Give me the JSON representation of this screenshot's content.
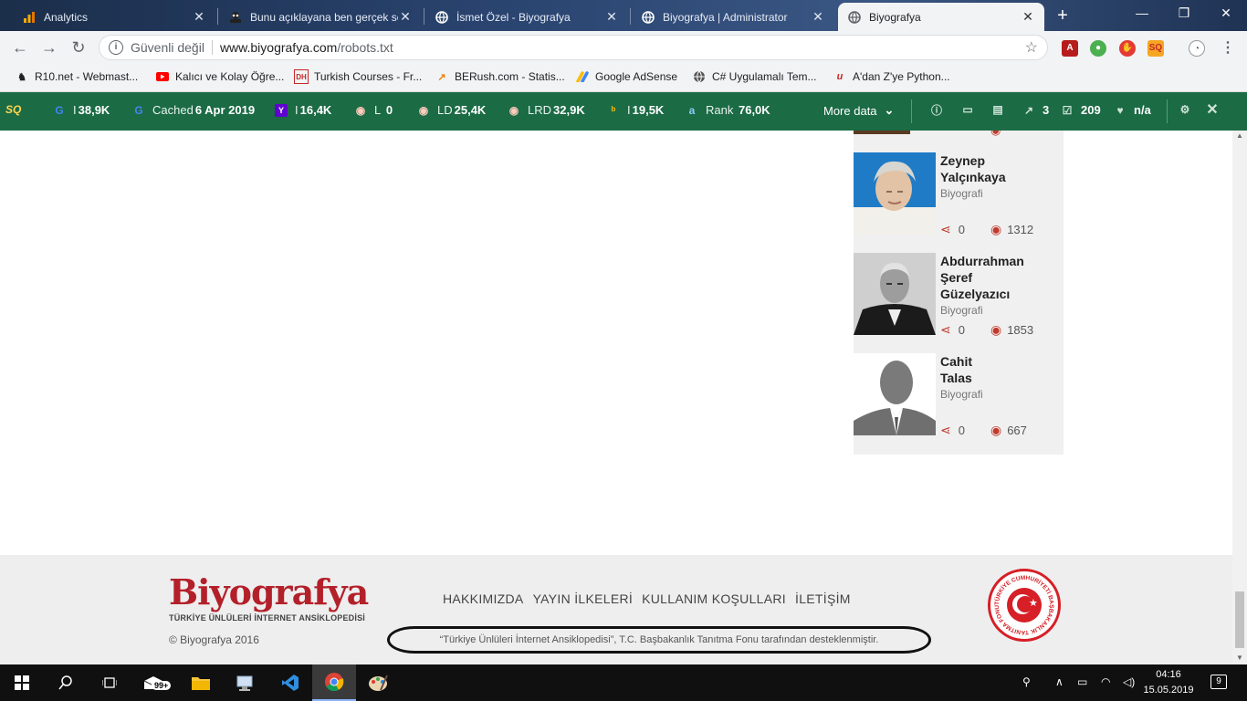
{
  "browser": {
    "tabs": [
      {
        "title": "Analytics",
        "icon": "analytics-icon"
      },
      {
        "title": "Bunu açıklayana ben gerçek se",
        "icon": "spy-icon"
      },
      {
        "title": "İsmet Özel - Biyografya",
        "icon": "globe-icon"
      },
      {
        "title": "Biyografya | Administrator",
        "icon": "globe-icon"
      },
      {
        "title": "Biyografya",
        "icon": "globe-icon",
        "active": true
      }
    ],
    "omnibox": {
      "security": "Güvenli değil",
      "domain": "www.biyografya.com",
      "path": "/robots.txt"
    },
    "bookmarks": [
      {
        "label": "R10.net - Webmast...",
        "icon": "r10-icon"
      },
      {
        "label": "Kalıcı ve Kolay Öğre...",
        "icon": "youtube-icon"
      },
      {
        "label": "Turkish Courses - Fr...",
        "icon": "dil-icon"
      },
      {
        "label": "BERush.com - Statis...",
        "icon": "berush-icon"
      },
      {
        "label": "Google AdSense",
        "icon": "adsense-icon"
      },
      {
        "label": "C# Uygulamalı Tem...",
        "icon": "globe-icon"
      },
      {
        "label": "A'dan Z'ye Python...",
        "icon": "udemy-icon"
      }
    ]
  },
  "seoquake": {
    "logo": "SQ",
    "metrics": [
      {
        "label": "I",
        "value": "38,9K",
        "icon": "google-icon"
      },
      {
        "label": "Cached",
        "value": "6 Apr 2019",
        "icon": "google-icon"
      },
      {
        "label": "I",
        "value": "16,4K",
        "icon": "yahoo-icon"
      },
      {
        "label": "L",
        "value": "0",
        "icon": "semrush-icon"
      },
      {
        "label": "LD",
        "value": "25,4K",
        "icon": "semrush-icon"
      },
      {
        "label": "LRD",
        "value": "32,9K",
        "icon": "semrush-icon"
      },
      {
        "label": "I",
        "value": "19,5K",
        "icon": "bing-icon"
      },
      {
        "label": "Rank",
        "value": "76,0K",
        "icon": "alexa-icon"
      }
    ],
    "more": "More data",
    "right": [
      {
        "value": "3",
        "icon": "external-links-icon"
      },
      {
        "value": "209",
        "icon": "internal-links-icon"
      },
      {
        "value": "n/a",
        "icon": "heart-icon"
      }
    ]
  },
  "sidebar": {
    "cards": [
      {
        "name": [
          "Zeynep",
          "Yalçınkaya"
        ],
        "category": "Biyografi",
        "shares": "0",
        "views": "1312"
      },
      {
        "name": [
          "Abdurrahman",
          "Şeref",
          "Güzelyazıcı"
        ],
        "category": "Biyografi",
        "shares": "0",
        "views": "1853"
      },
      {
        "name": [
          "Cahit",
          "Talas"
        ],
        "category": "Biyografi",
        "shares": "0",
        "views": "667"
      }
    ]
  },
  "footer": {
    "logo": "Biyografya",
    "logo_sub": "TÜRKİYE ÜNLÜLERİ İNTERNET ANSİKLOPEDİSİ",
    "copyright": "© Biyografya 2016",
    "nav": [
      "HAKKIMIZDA",
      "YAYIN İLKELERİ",
      "KULLANIM KOŞULLARI",
      "İLETİŞİM"
    ],
    "support": "“Türkiye Ünlüleri İnternet Ansiklopedisi”, T.C. Başbakanlık Tanıtma Fonu tarafından desteklenmiştir.",
    "seal_text": "TÜRKİYE CUMHURİYETİ BAŞBAKANLIK TANITMA FONU"
  },
  "taskbar": {
    "mail_badge": "99+",
    "time": "04:16",
    "date": "15.05.2019",
    "notifications": "9"
  },
  "colors": {
    "seo_bar": "#1b6b45",
    "brand_red": "#b3202a",
    "accent_red": "#c0392b"
  }
}
